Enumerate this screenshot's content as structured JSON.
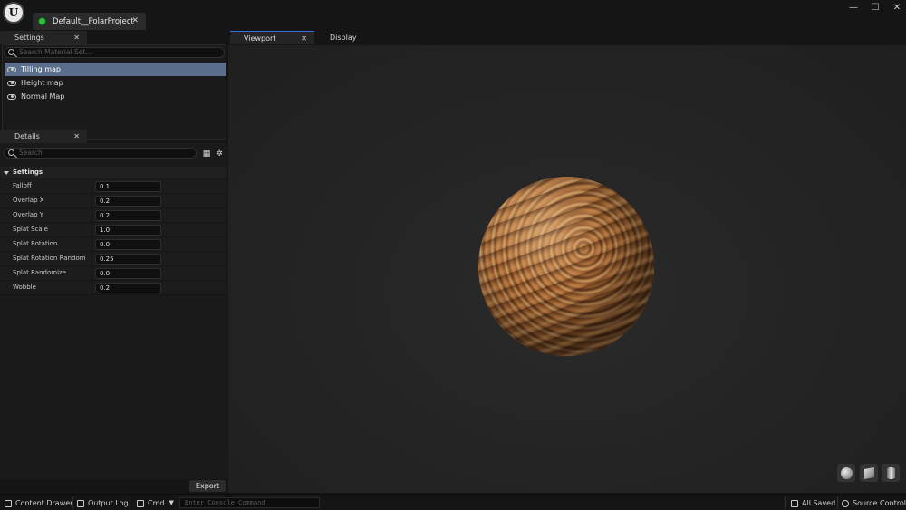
{
  "app": {
    "project_tab": "Default__PolarProject",
    "window_controls": {
      "minimize": "—",
      "maximize": "☐",
      "close": "✕"
    }
  },
  "settings_panel": {
    "tab_label": "Settings",
    "search_placeholder": "Search Material Set...",
    "layers": [
      {
        "label": "Tilling map",
        "selected": true
      },
      {
        "label": "Height map",
        "selected": false
      },
      {
        "label": "Normal Map",
        "selected": false
      }
    ]
  },
  "details_panel": {
    "tab_label": "Details",
    "search_placeholder": "Search",
    "section_label": "Settings",
    "properties": [
      {
        "name": "Falloff",
        "value": "0.1"
      },
      {
        "name": "Overlap X",
        "value": "0.2"
      },
      {
        "name": "Overlap Y",
        "value": "0.2"
      },
      {
        "name": "Splat Scale",
        "value": "1.0"
      },
      {
        "name": "Splat Rotation",
        "value": "0.0"
      },
      {
        "name": "Splat Rotation Random",
        "value": "0.25"
      },
      {
        "name": "Splat Randomize",
        "value": "0.0"
      },
      {
        "name": "Wobble",
        "value": "0.2"
      }
    ],
    "export_label": "Export"
  },
  "viewport": {
    "tab_label": "Viewport",
    "display_label": "Display",
    "preview_shapes": [
      "sphere-icon",
      "cube-icon",
      "cylinder-icon"
    ]
  },
  "statusbar": {
    "content_drawer": "Content Drawer",
    "output_log": "Output Log",
    "cmd": "Cmd",
    "console_placeholder": "Enter Console Command",
    "all_saved": "All Saved",
    "source_control": "Source Control"
  },
  "colors": {
    "selection": "#5b6f8c",
    "project_icon": "#2fbf3c",
    "background": "#151515"
  }
}
